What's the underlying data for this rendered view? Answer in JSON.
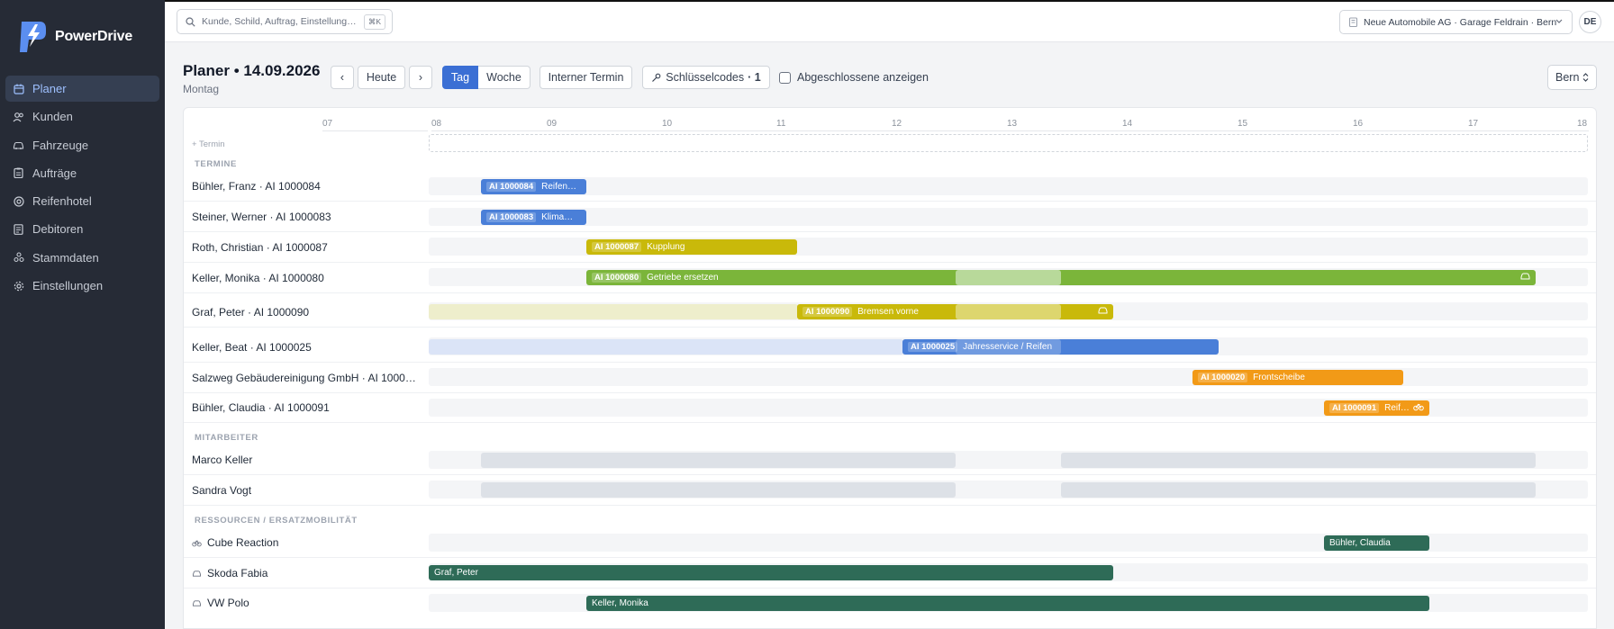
{
  "app": {
    "name": "PowerDrive"
  },
  "sidebar": {
    "items": [
      {
        "label": "Planer",
        "icon": "calendar-icon"
      },
      {
        "label": "Kunden",
        "icon": "users-icon"
      },
      {
        "label": "Fahrzeuge",
        "icon": "car-icon"
      },
      {
        "label": "Aufträge",
        "icon": "clipboard-icon"
      },
      {
        "label": "Reifenhotel",
        "icon": "tire-icon"
      },
      {
        "label": "Debitoren",
        "icon": "receipt-icon"
      },
      {
        "label": "Stammdaten",
        "icon": "database-icon"
      },
      {
        "label": "Einstellungen",
        "icon": "gear-icon"
      }
    ],
    "active": "Planer"
  },
  "topbar": {
    "search_placeholder": "Kunde, Schild, Auftrag, Einstellung…",
    "search_shortcut": "⌘K",
    "company": "Neue Automobile AG · Garage Feldrain · Bern",
    "avatar": "DE"
  },
  "toolbar": {
    "title": "Planer • 14.09.2026",
    "subtitle": "Montag",
    "prev": "‹",
    "today": "Heute",
    "next": "›",
    "view_day": "Tag",
    "view_week": "Woche",
    "internal": "Interner Termin",
    "keycodes": "Schlüsselcodes",
    "keycodes_count": "· 1",
    "show_completed": "Abgeschlossene anzeigen",
    "location": "Bern"
  },
  "grid": {
    "hours": [
      "07",
      "08",
      "09",
      "10",
      "11",
      "12",
      "13",
      "14",
      "15",
      "16",
      "17",
      "18"
    ],
    "add_term": "+ Termin",
    "sections": {
      "termine": "TERMINE",
      "mitarbeiter": "MITARBEITER",
      "ressourcen": "RESSOURCEN / ERSATZMOBILITÄT"
    },
    "termine": [
      {
        "label": "Bühler, Franz · AI 1000084",
        "code": "AI 1000084",
        "text": "Reifen…",
        "color": "#4a7fd8"
      },
      {
        "label": "Steiner, Werner · AI 1000083",
        "code": "AI 1000083",
        "text": "Klima…",
        "color": "#4a7fd8"
      },
      {
        "label": "Roth, Christian · AI 1000087",
        "code": "AI 1000087",
        "text": "Kupplung",
        "color": "#c9b90a"
      },
      {
        "label": "Keller, Monika · AI 1000080",
        "code": "AI 1000080",
        "text": "Getriebe ersetzen",
        "color": "#7bb53a"
      },
      {
        "label": "Graf, Peter · AI 1000090",
        "code": "AI 1000090",
        "text": "Bremsen vorne",
        "color": "#c9b90a"
      },
      {
        "label": "Keller, Beat · AI 1000025",
        "code": "AI 1000025",
        "text": "Jahresservice / Reifen",
        "color": "#4a7fd8"
      },
      {
        "label": "Salzweg Gebäudereinigung GmbH · AI 1000…",
        "code": "AI 1000020",
        "text": "Frontscheibe",
        "color": "#f29a17"
      },
      {
        "label": "Bühler, Claudia · AI 1000091",
        "code": "AI 1000091",
        "text": "Reif…",
        "color": "#f29a17"
      }
    ],
    "mitarbeiter": [
      {
        "label": "Marco Keller"
      },
      {
        "label": "Sandra Vogt"
      }
    ],
    "ressourcen": [
      {
        "label": "Cube Reaction",
        "icon": "bicycle-icon",
        "booking": "Bühler, Claudia"
      },
      {
        "label": "Skoda Fabia",
        "icon": "car-icon",
        "booking": "Graf, Peter"
      },
      {
        "label": "VW Polo",
        "icon": "car-icon",
        "booking": "Keller, Monika"
      }
    ],
    "resource_color": "#2e6b57"
  }
}
